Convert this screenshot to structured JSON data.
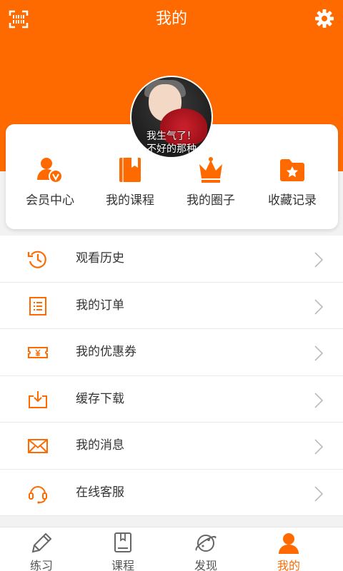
{
  "header": {
    "title": "我的"
  },
  "avatar_caption": {
    "line1": "我生气了！",
    "line2": "不好的那种"
  },
  "quick": [
    {
      "label": "会员中心",
      "icon": "member-icon"
    },
    {
      "label": "我的课程",
      "icon": "book-icon"
    },
    {
      "label": "我的圈子",
      "icon": "crown-icon"
    },
    {
      "label": "收藏记录",
      "icon": "star-folder-icon"
    }
  ],
  "menu": [
    {
      "label": "观看历史",
      "icon": "history-icon"
    },
    {
      "label": "我的订单",
      "icon": "order-icon"
    },
    {
      "label": "我的优惠券",
      "icon": "coupon-icon"
    },
    {
      "label": "缓存下载",
      "icon": "download-icon"
    },
    {
      "label": "我的消息",
      "icon": "mail-icon"
    },
    {
      "label": "在线客服",
      "icon": "headset-icon"
    }
  ],
  "tabs": [
    {
      "label": "练习",
      "icon": "pencil-icon"
    },
    {
      "label": "课程",
      "icon": "course-icon"
    },
    {
      "label": "发现",
      "icon": "planet-icon"
    },
    {
      "label": "我的",
      "icon": "user-icon",
      "active": true
    }
  ],
  "colors": {
    "accent": "#ff6a00",
    "inactive": "#555555"
  }
}
